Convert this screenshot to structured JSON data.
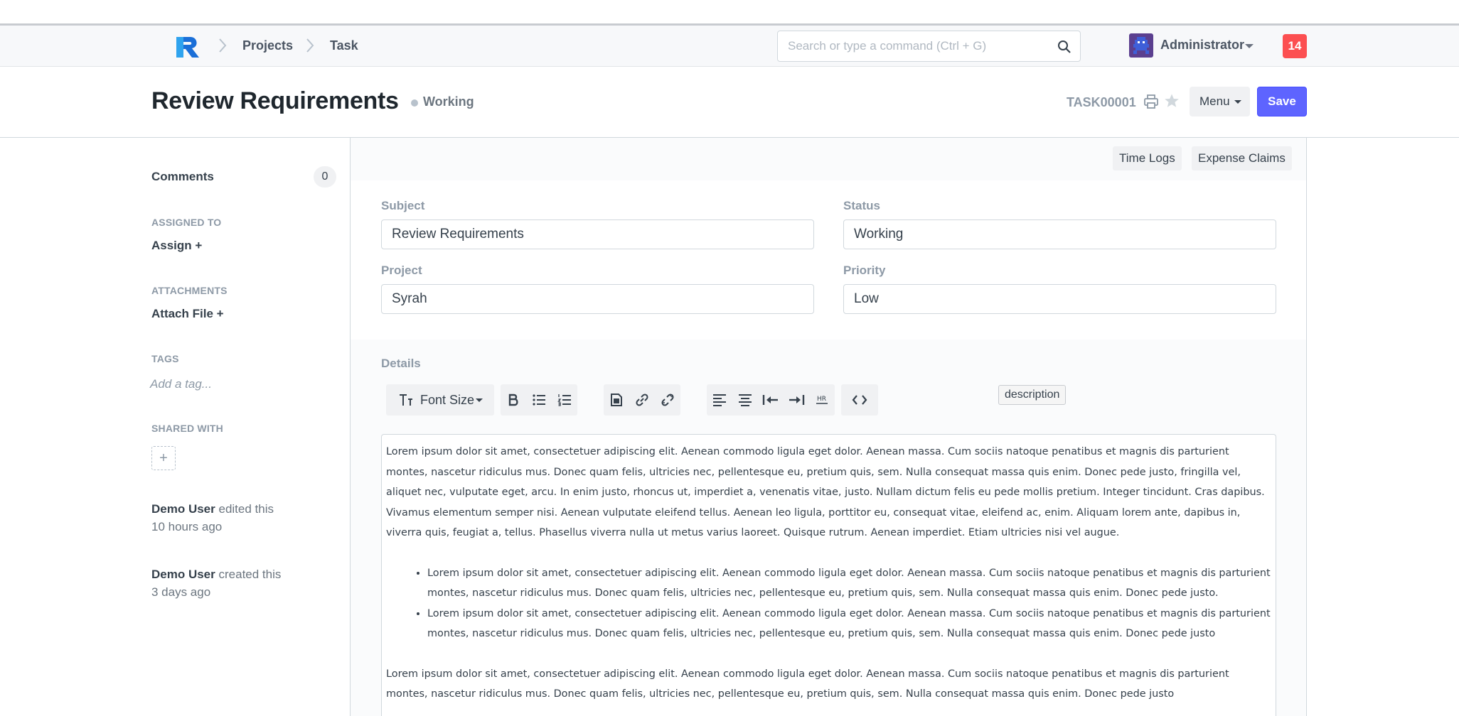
{
  "navbar": {
    "breadcrumbs": [
      "Projects",
      "Task"
    ],
    "search_placeholder": "Search or type a command (Ctrl + G)",
    "user_name": "Administrator",
    "notification_count": "14",
    "notification_color": "#fc4f51"
  },
  "page": {
    "title": "Review Requirements",
    "status": "Working",
    "doc_name": "TASK00001",
    "menu_label": "Menu",
    "save_label": "Save",
    "accent_color": "#5e64ff"
  },
  "sidebar": {
    "comments_label": "Comments",
    "comments_count": "0",
    "assigned_to_label": "ASSIGNED TO",
    "assign_label": "Assign +",
    "attachments_label": "ATTACHMENTS",
    "attach_label": "Attach File +",
    "tags_label": "TAGS",
    "add_tag_placeholder": "Add a tag...",
    "shared_with_label": "SHARED WITH",
    "share_plus": "+",
    "activity": [
      {
        "user": "Demo User",
        "action": "edited this",
        "time": "10 hours ago"
      },
      {
        "user": "Demo User",
        "action": "created this",
        "time": "3 days ago"
      }
    ]
  },
  "form": {
    "links": [
      "Time Logs",
      "Expense Claims"
    ],
    "subject_label": "Subject",
    "subject_value": "Review Requirements",
    "status_label": "Status",
    "status_value": "Working",
    "project_label": "Project",
    "project_value": "Syrah",
    "priority_label": "Priority",
    "priority_value": "Low",
    "details_label": "Details",
    "font_size_label": "Font Size",
    "tooltip": "description",
    "toolbar_icons": [
      "font-size-icon",
      "bold-icon",
      "bullet-list-icon",
      "numbered-list-icon",
      "image-icon",
      "link-icon",
      "unlink-icon",
      "align-left-icon",
      "align-center-icon",
      "outdent-icon",
      "indent-icon",
      "horizontal-rule-icon",
      "code-view-icon"
    ],
    "description": {
      "para1": "Lorem ipsum dolor sit amet, consectetuer adipiscing elit. Aenean commodo ligula eget dolor. Aenean massa. Cum sociis natoque penatibus et magnis dis parturient montes, nascetur ridiculus mus. Donec quam felis, ultricies nec, pellentesque eu, pretium quis, sem. Nulla consequat massa quis enim. Donec pede justo, fringilla vel, aliquet nec, vulputate eget, arcu. In enim justo, rhoncus ut, imperdiet a, venenatis vitae, justo. Nullam dictum felis eu pede mollis pretium. Integer tincidunt. Cras dapibus. Vivamus elementum semper nisi. Aenean vulputate eleifend tellus. Aenean leo ligula, porttitor eu, consequat vitae, eleifend ac, enim. Aliquam lorem ante, dapibus in, viverra quis, feugiat a, tellus. Phasellus viverra nulla ut metus varius laoreet. Quisque rutrum. Aenean imperdiet. Etiam ultricies nisi vel augue.",
      "bullets": [
        "Lorem ipsum dolor sit amet, consectetuer adipiscing elit. Aenean commodo ligula eget dolor. Aenean massa. Cum sociis natoque penatibus et magnis dis parturient montes, nascetur ridiculus mus. Donec quam felis, ultricies nec, pellentesque eu, pretium quis, sem. Nulla consequat massa quis enim. Donec pede justo.",
        "Lorem ipsum dolor sit amet, consectetuer adipiscing elit. Aenean commodo ligula eget dolor. Aenean massa. Cum sociis natoque penatibus et magnis dis parturient montes, nascetur ridiculus mus. Donec quam felis, ultricies nec, pellentesque eu, pretium quis, sem. Nulla consequat massa quis enim. Donec pede justo"
      ],
      "para2": "Lorem ipsum dolor sit amet, consectetuer adipiscing elit. Aenean commodo ligula eget dolor. Aenean massa. Cum sociis natoque penatibus et magnis dis parturient montes, nascetur ridiculus mus. Donec quam felis, ultricies nec, pellentesque eu, pretium quis, sem. Nulla consequat massa quis enim. Donec pede justo"
    }
  }
}
